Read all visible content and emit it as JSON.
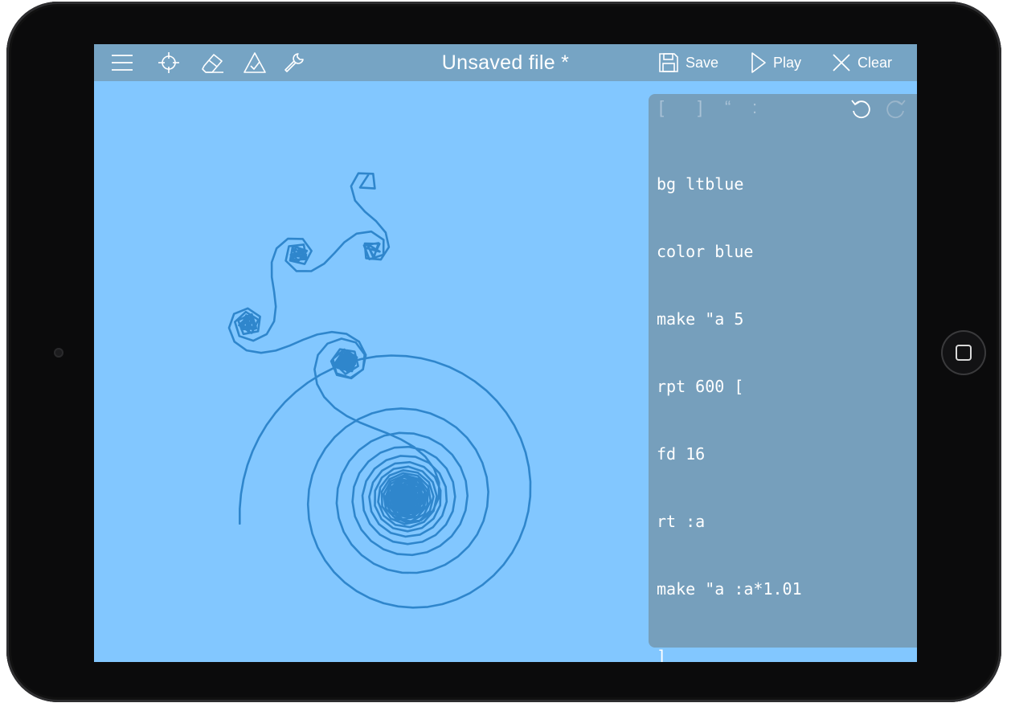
{
  "toolbar": {
    "title": "Unsaved file *",
    "icons": [
      "menu-icon",
      "crosshair-icon",
      "eraser-icon",
      "triangle-check-icon",
      "wrench-icon"
    ],
    "save_label": "Save",
    "play_label": "Play",
    "clear_label": "Clear"
  },
  "editor": {
    "keys": [
      "[",
      "]",
      "“",
      ":"
    ],
    "code": [
      "bg ltblue",
      "color blue",
      "make \"a 5",
      "rpt 600 [",
      "fd 16",
      "rt :a",
      "make \"a :a*1.01",
      "]"
    ]
  },
  "colors": {
    "canvas_background": "#82c7ff",
    "toolbar_background": "#76a4c4",
    "editor_background": "#769fbc",
    "pen_color": "#2f86cc"
  },
  "drawing": {
    "start_heading_deg": 0,
    "repeat": 600,
    "step": 16,
    "initial_angle": 5,
    "angle_multiplier": 1.01
  }
}
